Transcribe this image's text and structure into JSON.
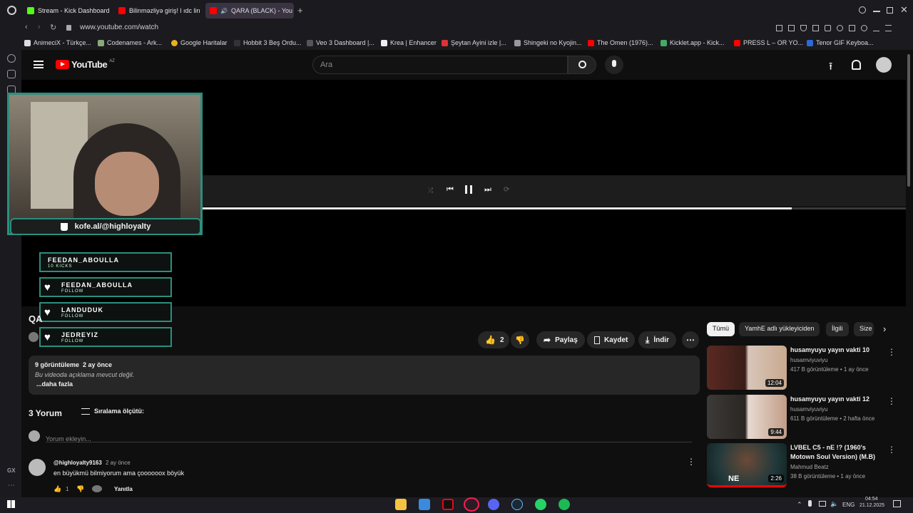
{
  "browser": {
    "tabs": [
      {
        "label": "Stream - Kick Dashboard",
        "color": "#53fc18"
      },
      {
        "label": "Bilinməzliyə giriş! l ıdc lin",
        "color": "#ff0000"
      },
      {
        "label": "QARA (BLACK) - You",
        "color": "#ff0000"
      }
    ],
    "new_tab": "+",
    "url": "www.youtube.com/watch",
    "bookmarks": [
      "AnimeciX - Türkçe...",
      "Codenames - Ark...",
      "Google Haritalar",
      "Hobbit 3 Beş Ordu...",
      "Veo 3 Dashboard |...",
      "Krea | Enhancer",
      "Şeytan Ayini izle |...",
      "Shingeki no Kyojin...",
      "The Omen (1976)...",
      "Kicklet.app - Kick...",
      "PRESS L – OR YO...",
      "Tenor GIF Keyboa..."
    ],
    "rail_label": "GX"
  },
  "youtube": {
    "logo": "YouTube",
    "region": "AZ",
    "search_placeholder": "Ara",
    "overlay": {
      "kofe": "kofe.al/@highloyalty",
      "alerts": [
        {
          "name": "FEEDAN_ABOULLA",
          "sub": "10 KICKS",
          "heart": false
        },
        {
          "name": "FEEDAN_ABOULLA",
          "sub": "FOLLOW",
          "heart": true
        },
        {
          "name": "LANDUDUK",
          "sub": "FOLLOW",
          "heart": true
        },
        {
          "name": "JEDREYIZ",
          "sub": "FOLLOW",
          "heart": true
        }
      ]
    },
    "player": {
      "progress": 0.8377
    },
    "video": {
      "title_partial": "QA",
      "like_count": "2",
      "share": "Paylaş",
      "save": "Kaydet",
      "download": "İndir"
    },
    "description": {
      "stats": "9 görüntüleme  2 ay önce",
      "text": "Bu videoda açıklama mevcut değil.",
      "more": "...daha fazla"
    },
    "comments": {
      "count_label": "3 Yorum",
      "sort_label": "Sıralama ölçütü:",
      "add_placeholder": "Yorum ekleyin...",
      "items": [
        {
          "author": "@highloyalty9163",
          "time": "2 ay önce",
          "text": "en büyükmü bilmiyorum ama çoooooox böyük",
          "likes": "1",
          "reply": "Yanıtla"
        }
      ]
    },
    "chips": [
      "Tümü",
      "YamhE adlı yükleyiciden",
      "İlgili",
      "Size"
    ],
    "sidebar": [
      {
        "title": "husamyuyu yayın vakti 10",
        "channel": "husamviyuviyu",
        "meta": "417 B görüntüleme • 1 ay önce",
        "duration": "12:04"
      },
      {
        "title": "husamyuyu yayın vakti 12",
        "channel": "husamviyuviyu",
        "meta": "611 B görüntüleme • 2 hafta önce",
        "duration": "9:44"
      },
      {
        "title": "LVBEL C5 - nE !? (1960's Motown Soul Version) (M.B)",
        "channel": "Mahmud Beatz",
        "meta": "38 B görüntüleme • 1 ay önce",
        "duration": "2:26"
      }
    ]
  },
  "taskbar": {
    "lang": "ENG",
    "time": "04:54",
    "date": "21.12.2025"
  }
}
